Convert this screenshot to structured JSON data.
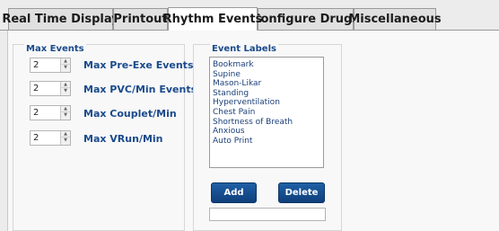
{
  "tabs": [
    {
      "label": "Real Time Display",
      "active": false
    },
    {
      "label": "Printout",
      "active": false
    },
    {
      "label": "Rhythm Events",
      "active": true
    },
    {
      "label": "Configure Drugs",
      "active": false
    },
    {
      "label": "Miscellaneous",
      "active": false
    }
  ],
  "max_events": {
    "title": "Max Events",
    "fields": [
      {
        "value": "2",
        "label": "Max Pre-Exe Events"
      },
      {
        "value": "2",
        "label": "Max PVC/Min Events"
      },
      {
        "value": "2",
        "label": "Max Couplet/Min"
      },
      {
        "value": "2",
        "label": "Max VRun/Min"
      }
    ]
  },
  "event_labels": {
    "title": "Event Labels",
    "items": [
      "Bookmark",
      "Supine",
      "Mason-Likar",
      "Standing",
      "Hyperventilation",
      "Chest Pain",
      "Shortness of Breath",
      "Anxious",
      "Auto Print"
    ],
    "add_label": "Add",
    "delete_label": "Delete",
    "new_label_value": ""
  }
}
